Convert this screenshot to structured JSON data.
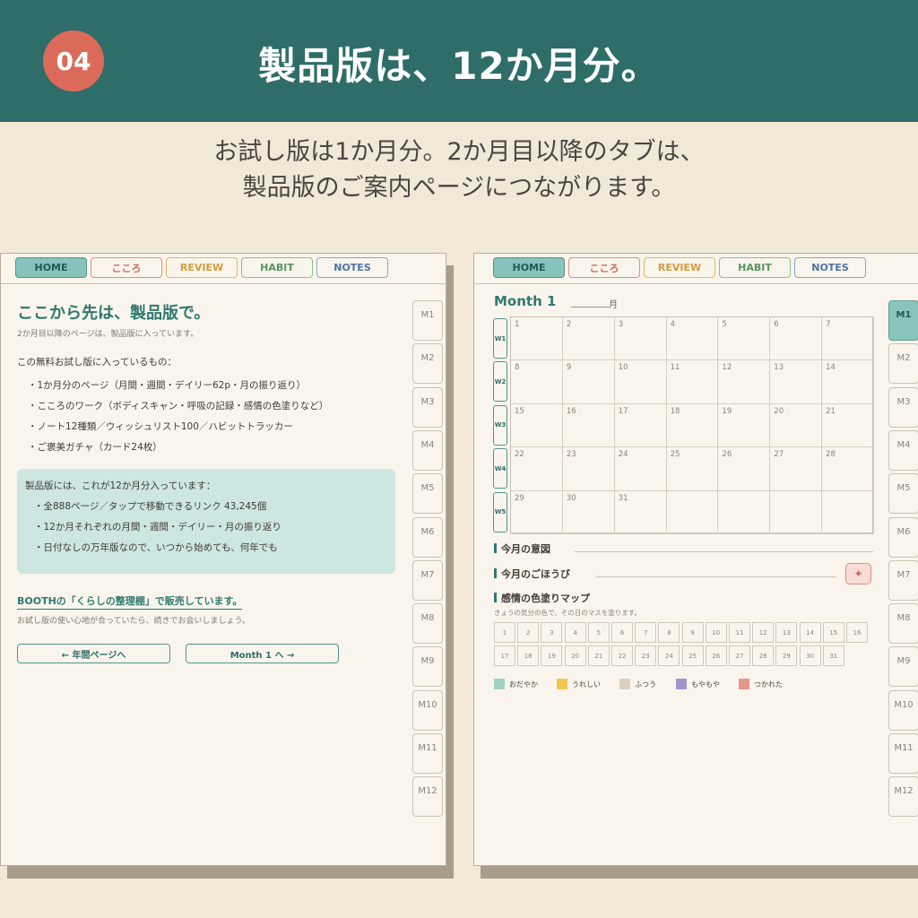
{
  "header": {
    "badge": "04",
    "title": "製品版は、12か月分。"
  },
  "subtitle": {
    "line1": "お試し版は1か月分。2か月目以降のタブは、",
    "line2": "製品版のご案内ページにつながります。"
  },
  "tabs": [
    "HOME",
    "こころ",
    "REVIEW",
    "HABIT",
    "NOTES"
  ],
  "side_tabs": [
    "M1",
    "M2",
    "M3",
    "M4",
    "M5",
    "M6",
    "M7",
    "M8",
    "M9",
    "M10",
    "M11",
    "M12"
  ],
  "left_page": {
    "title": "ここから先は、製品版で。",
    "subtitle": "2か月目以降のページは、製品版に入っています。",
    "intro": "この無料お試し版に入っているもの：",
    "items": [
      "・1か月分のページ（月間・週間・デイリー62p・月の振り返り）",
      "・こころのワーク（ボディスキャン・呼吸の記録・感情の色塗りなど）",
      "・ノート12種類／ウィッシュリスト100／ハビットトラッカー",
      "・ご褒美ガチャ（カード24枚）"
    ],
    "box_title": "製品版には、これが12か月分入っています：",
    "box_items": [
      "・全888ページ／タップで移動できるリンク 43,245個",
      "・12か月それぞれの月間・週間・デイリー・月の振り返り",
      "・日付なしの万年版なので、いつから始めても、何年でも"
    ],
    "booth": "BOOTHの「くらしの整理棚」で販売しています。",
    "booth_sub": "お試し版の使い心地が合っていたら、続きでお会いしましょう。",
    "btn_prev": "← 年間ページへ",
    "btn_next": "Month 1 へ →"
  },
  "right_page": {
    "title": "Month 1",
    "month_unit": "月",
    "weeks": [
      "W1",
      "W2",
      "W3",
      "W4",
      "W5"
    ],
    "days": [
      "1",
      "2",
      "3",
      "4",
      "5",
      "6",
      "7",
      "8",
      "9",
      "10",
      "11",
      "12",
      "13",
      "14",
      "15",
      "16",
      "17",
      "18",
      "19",
      "20",
      "21",
      "22",
      "23",
      "24",
      "25",
      "26",
      "27",
      "28",
      "29",
      "30",
      "31"
    ],
    "intent_label": "今月の意図",
    "reward_label": "今月のごほうび",
    "mood_title": "感情の色塗りマップ",
    "mood_sub": "きょうの気分の色で、その日のマスを塗ります。",
    "legend": [
      {
        "label": "おだやか",
        "color": "#9fd1c2"
      },
      {
        "label": "うれしい",
        "color": "#efc64e"
      },
      {
        "label": "ふつう",
        "color": "#d9d0c1"
      },
      {
        "label": "もやもや",
        "color": "#9f97cc"
      },
      {
        "label": "つかれた",
        "color": "#e3968a"
      }
    ]
  },
  "colors": {
    "banner": "#2e6d68",
    "badge": "#dc6a5a",
    "accent": "#2d7a72"
  }
}
